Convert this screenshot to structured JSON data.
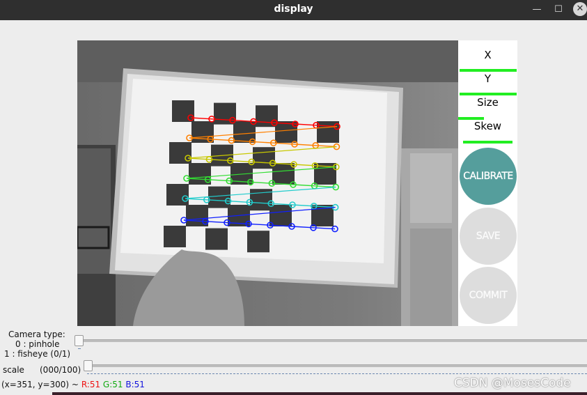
{
  "window": {
    "title": "display",
    "minimize_glyph": "—",
    "maximize_glyph": "☐",
    "close_glyph": "✕"
  },
  "panel": {
    "params": [
      {
        "label": "X",
        "fraction": 0.96
      },
      {
        "label": "Y",
        "fraction": 0.96
      },
      {
        "label": "Size",
        "fraction": 0.43
      },
      {
        "label": "Skew",
        "fraction": 0.83
      }
    ],
    "buttons": {
      "calibrate": "CALIBRATE",
      "save": "SAVE",
      "commit": "COMMIT"
    },
    "colors": {
      "bar": "#22ee22",
      "calibrate": "#559e9c",
      "disabled": "#dddddd"
    }
  },
  "controls": {
    "camera_type": {
      "label_line1": "Camera type:",
      "label_line2": "0 : pinhole",
      "label_line3": "1 : fisheye (0/1)",
      "value": 0,
      "max": 1
    },
    "scale": {
      "label": "scale",
      "value_text": "(000/100)",
      "value": 0,
      "max": 100
    }
  },
  "status": {
    "coords": "(x=351, y=300) ~",
    "r": "R:51",
    "g": "G:51",
    "b": "B:51"
  },
  "watermark": "CSDN @MosesCode",
  "detected_corner_colors": [
    "#ff0000",
    "#ff8000",
    "#c8c800",
    "#33dd33",
    "#22cccc",
    "#1020ff"
  ]
}
